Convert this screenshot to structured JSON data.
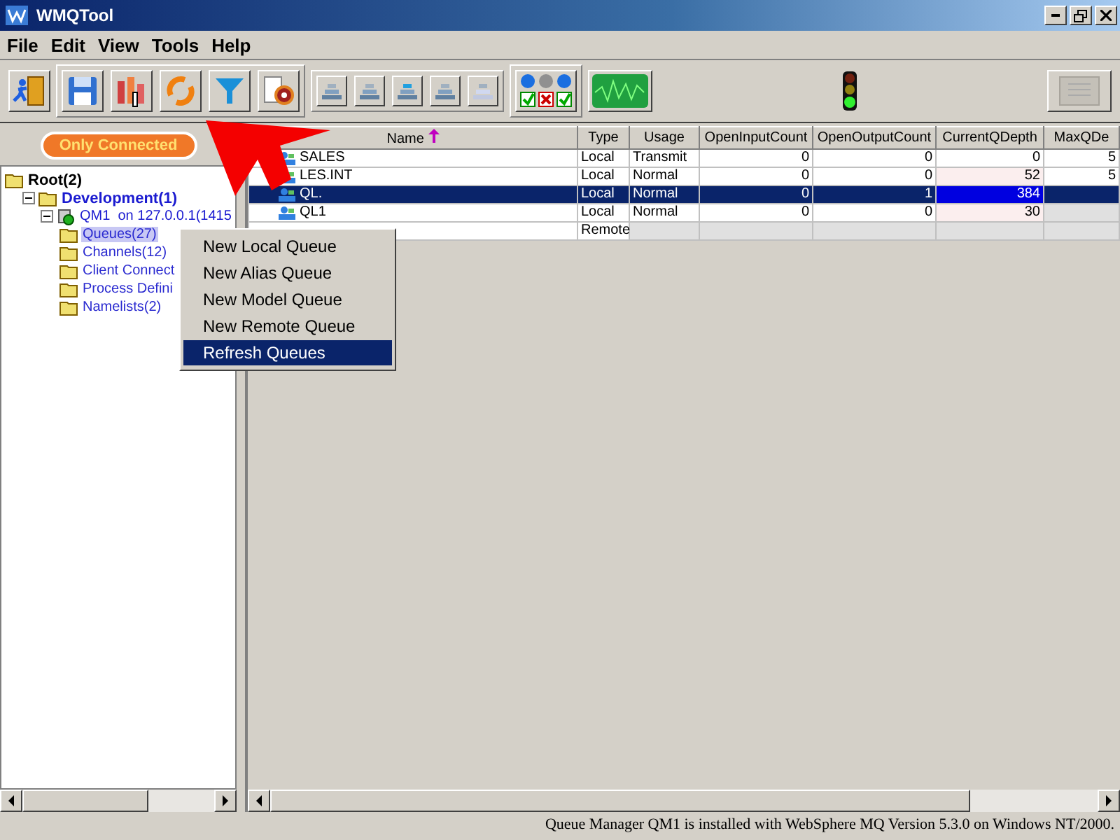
{
  "window": {
    "title": "WMQTool"
  },
  "menu": [
    "File",
    "Edit",
    "View",
    "Tools",
    "Help"
  ],
  "filter_button": {
    "label": "Only Connected"
  },
  "tree": [
    {
      "label": "Root(2)",
      "kind": "root",
      "selected": false,
      "children": [
        {
          "label": "Development(1)",
          "kind": "group",
          "selected": false,
          "children": [
            {
              "label": "QM1  on 127.0.0.1(1415",
              "kind": "manager",
              "selected": false,
              "children": [
                {
                  "label": "Queues(27)",
                  "kind": "folder",
                  "selected": true
                },
                {
                  "label": "Channels(12)",
                  "kind": "folder",
                  "selected": false
                },
                {
                  "label": "Client Connect",
                  "kind": "folder",
                  "selected": false
                },
                {
                  "label": "Process Defini",
                  "kind": "folder",
                  "selected": false
                },
                {
                  "label": "Namelists(2)",
                  "kind": "folder",
                  "selected": false
                }
              ]
            }
          ]
        }
      ]
    }
  ],
  "table": {
    "columns": [
      {
        "label": "Name",
        "sorted": true
      },
      {
        "label": "Type",
        "sorted": false
      },
      {
        "label": "Usage",
        "sorted": false
      },
      {
        "label": "OpenInputCount",
        "sorted": false
      },
      {
        "label": "OpenOutputCount",
        "sorted": false
      },
      {
        "label": "CurrentQDepth",
        "sorted": false
      },
      {
        "label": "MaxQDe",
        "sorted": false
      }
    ],
    "rows": [
      {
        "name": "SALES",
        "values": [
          "Local",
          "Transmit",
          "0",
          "0",
          "0",
          "5"
        ],
        "selected": false
      },
      {
        "name": "LES.INT",
        "values": [
          "Local",
          "Normal",
          "0",
          "0",
          "52",
          "5"
        ],
        "selected": false
      },
      {
        "name": "QL.",
        "values": [
          "Local",
          "Normal",
          "0",
          "1",
          "384"
        ],
        "selected": true
      },
      {
        "name": "QL1",
        "values": [
          "Local",
          "Normal",
          "0",
          "0",
          "30"
        ],
        "selected": false
      },
      {
        "values": [
          "Remote"
        ],
        "selected": false
      }
    ]
  },
  "context_menu": [
    {
      "label": "New Local Queue",
      "selected": false
    },
    {
      "label": "New Alias Queue",
      "selected": false
    },
    {
      "label": "New Model Queue",
      "selected": false
    },
    {
      "label": "New Remote Queue",
      "selected": false
    },
    {
      "label": "Refresh Queues",
      "selected": true
    }
  ],
  "status_bar": "Queue Manager QM1  is installed with WebSphere MQ Version 5.3.0 on Windows NT/2000."
}
